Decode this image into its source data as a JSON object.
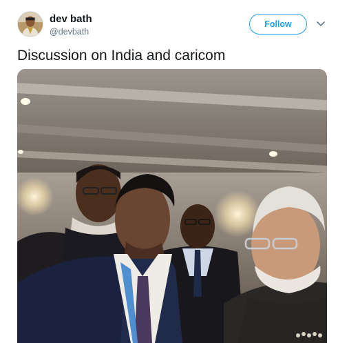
{
  "user": {
    "display_name": "dev bath",
    "handle": "@devbath"
  },
  "actions": {
    "follow_label": "Follow"
  },
  "tweet": {
    "text": "Discussion on India and caricom"
  },
  "icons": {
    "caret": "chevron-down-icon",
    "avatar": "profile-photo"
  },
  "colors": {
    "accent": "#1da1f2",
    "text": "#14171a",
    "secondary": "#657786"
  }
}
